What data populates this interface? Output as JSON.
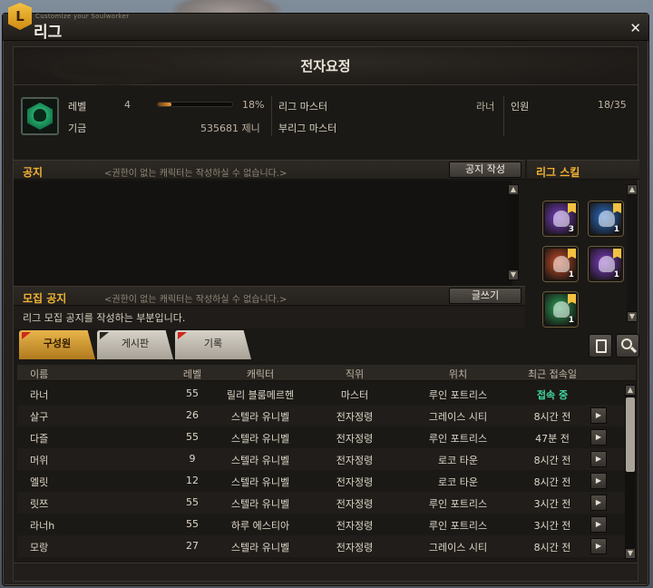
{
  "window": {
    "subtitle": "Customize your Soulworker",
    "title": "리그",
    "badge": "L",
    "close": "✕"
  },
  "guild": {
    "name": "전자요정",
    "level_label": "레벨",
    "level": "4",
    "xp_percent_text": "18%",
    "xp_progress": 0.18,
    "fund_label": "기금",
    "fund": "535681 제니",
    "master_label": "리그 마스터",
    "master": "라너",
    "submaster_label": "부리그 마스터",
    "submaster": "",
    "members_label": "인원",
    "members": "18/35"
  },
  "notice": {
    "title": "공지",
    "hint": "<권한이 없는 캐릭터는 작성하실 수 없습니다.>",
    "write_button": "공지 작성"
  },
  "recruit": {
    "title": "모집 공지",
    "hint": "<권한이 없는 캐릭터는 작성하실 수 없습니다.>",
    "write_button": "글쓰기",
    "body": "리그 모집 공지를 작성하는 부분입니다."
  },
  "skills": {
    "title": "리그 스킬",
    "items": [
      {
        "name": "member-plus-skill",
        "count": "3",
        "color": "#7a3fc8"
      },
      {
        "name": "storage-skill",
        "count": "1",
        "color": "#2c6fc8"
      },
      {
        "name": "buff-chain-skill",
        "count": "1",
        "color": "#c8502c"
      },
      {
        "name": "group-aura-skill",
        "count": "1",
        "color": "#7f3fc8"
      },
      {
        "name": "leaf-exp-skill",
        "count": "1",
        "color": "#2ea15a"
      }
    ]
  },
  "tabs": [
    {
      "label": "구성원",
      "active": true,
      "flag_color": "#d0281e"
    },
    {
      "label": "게시판",
      "active": false,
      "flag_color": "#2a2620"
    },
    {
      "label": "기록",
      "active": false,
      "flag_color": "#d0281e"
    }
  ],
  "members_table": {
    "headers": [
      "이름",
      "레벨",
      "캐릭터",
      "직위",
      "위치",
      "최근 접속일"
    ],
    "rows": [
      {
        "name": "라너",
        "level": "55",
        "character": "릴리 블룸메르헨",
        "rank": "마스터",
        "location": "루인 포트리스",
        "last_login": "접속 중",
        "online": true
      },
      {
        "name": "살구",
        "level": "26",
        "character": "스텔라 유니벨",
        "rank": "전자정령",
        "location": "그레이스 시티",
        "last_login": "8시간 전",
        "online": false
      },
      {
        "name": "다즐",
        "level": "55",
        "character": "스텔라 유니벨",
        "rank": "전자정령",
        "location": "루인 포트리스",
        "last_login": "47분 전",
        "online": false
      },
      {
        "name": "머위",
        "level": "9",
        "character": "스텔라 유니벨",
        "rank": "전자정령",
        "location": "로코 타운",
        "last_login": "8시간 전",
        "online": false
      },
      {
        "name": "엘릿",
        "level": "12",
        "character": "스텔라 유니벨",
        "rank": "전자정령",
        "location": "로코 타운",
        "last_login": "8시간 전",
        "online": false
      },
      {
        "name": "릿쯔",
        "level": "55",
        "character": "스텔라 유니벨",
        "rank": "전자정령",
        "location": "루인 포트리스",
        "last_login": "3시간 전",
        "online": false
      },
      {
        "name": "라너h",
        "level": "55",
        "character": "하루 에스티아",
        "rank": "전자정령",
        "location": "루인 포트리스",
        "last_login": "3시간 전",
        "online": false
      },
      {
        "name": "모랑",
        "level": "27",
        "character": "스텔라 유니벨",
        "rank": "전자정령",
        "location": "그레이스 시티",
        "last_login": "8시간 전",
        "online": false
      }
    ]
  },
  "glyphs": {
    "row_arrow": "▶",
    "scroll_up": "▲",
    "scroll_down": "▼"
  }
}
